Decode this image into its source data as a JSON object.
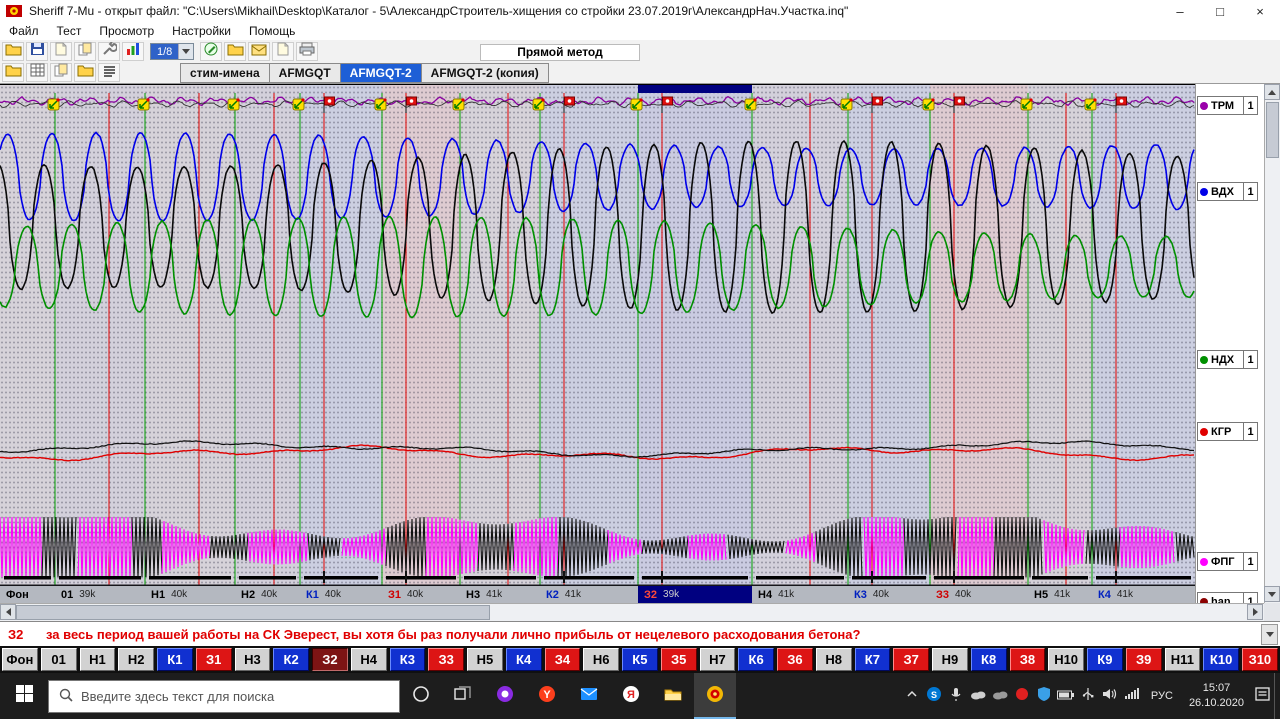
{
  "window": {
    "title": "Sheriff 7-Mu - открыт файл: \"C:\\Users\\Mikhail\\Desktop\\Каталог - 5\\АлександрСтроитель-хищения со стройки 23.07.2019г\\АлександрНач.Участка.inq\"",
    "menu": [
      "Файл",
      "Тест",
      "Просмотр",
      "Настройки",
      "Помощь"
    ],
    "controls": [
      {
        "name": "minimize-button",
        "glyph": "–"
      },
      {
        "name": "maximize-button",
        "glyph": "□"
      },
      {
        "name": "close-button",
        "glyph": "×"
      }
    ]
  },
  "toolbar": {
    "scale_value": "1/8",
    "method_label": "Прямой метод",
    "row1a_icons": [
      "open-file",
      "save",
      "page",
      "copy",
      "wrench",
      "chart"
    ],
    "row1b_icons": [
      "pencil",
      "open-file",
      "mail-tb",
      "page",
      "print"
    ],
    "row2_icons": [
      "open-file",
      "grid",
      "copy",
      "open-file",
      "list"
    ]
  },
  "tabs": [
    {
      "label": "стим-имена",
      "active": false
    },
    {
      "label": "AFMGQT",
      "active": false
    },
    {
      "label": "AFMGQT-2",
      "active": true
    },
    {
      "label": "AFMGQT-2 (копия)",
      "active": false
    }
  ],
  "channels": [
    {
      "label": "ТРМ",
      "index": "1",
      "color": "#9900aa"
    },
    {
      "label": "ВДХ",
      "index": "1",
      "color": "#0000e8"
    },
    {
      "label": "НДХ",
      "index": "1",
      "color": "#009000"
    },
    {
      "label": "КГР",
      "index": "1",
      "color": "#e00000"
    },
    {
      "label": "ФПГ",
      "index": "1",
      "color": "#ff00ff"
    },
    {
      "label": "han",
      "index": "1",
      "color": "#8b0000"
    }
  ],
  "chart": {
    "segments": [
      {
        "label": "Фон",
        "sub": "",
        "type": "fon",
        "start": 0,
        "end": 55
      },
      {
        "label": "01",
        "sub": "39k",
        "type": "n",
        "start": 55,
        "end": 145
      },
      {
        "label": "Н1",
        "sub": "40k",
        "type": "n",
        "start": 145,
        "end": 235
      },
      {
        "label": "Н2",
        "sub": "40k",
        "type": "n",
        "start": 235,
        "end": 300
      },
      {
        "label": "К1",
        "sub": "40k",
        "type": "k",
        "start": 300,
        "end": 382
      },
      {
        "label": "З1",
        "sub": "40k",
        "type": "z",
        "start": 382,
        "end": 460
      },
      {
        "label": "Н3",
        "sub": "41k",
        "type": "n",
        "start": 460,
        "end": 540
      },
      {
        "label": "К2",
        "sub": "41k",
        "type": "k",
        "start": 540,
        "end": 638
      },
      {
        "label": "З2",
        "sub": "39k",
        "type": "z",
        "start": 638,
        "end": 752,
        "selected": true
      },
      {
        "label": "Н4",
        "sub": "41k",
        "type": "n",
        "start": 752,
        "end": 848
      },
      {
        "label": "К3",
        "sub": "40k",
        "type": "k",
        "start": 848,
        "end": 930
      },
      {
        "label": "З3",
        "sub": "40k",
        "type": "z",
        "start": 930,
        "end": 1028
      },
      {
        "label": "Н5",
        "sub": "41k",
        "type": "n",
        "start": 1028,
        "end": 1092
      },
      {
        "label": "К4",
        "sub": "41k",
        "type": "k",
        "start": 1092,
        "end": 1195
      }
    ]
  },
  "question": {
    "id": "З2",
    "text": "за весь период вашей работы на СК Эверест, вы хотя бы раз получали лично прибыль от нецелевого расходования бетона?"
  },
  "question_buttons": [
    {
      "label": "Фон",
      "type": "n"
    },
    {
      "label": "01",
      "type": "n"
    },
    {
      "label": "Н1",
      "type": "n"
    },
    {
      "label": "Н2",
      "type": "n"
    },
    {
      "label": "К1",
      "type": "k"
    },
    {
      "label": "З1",
      "type": "z"
    },
    {
      "label": "Н3",
      "type": "n"
    },
    {
      "label": "К2",
      "type": "k"
    },
    {
      "label": "З2",
      "type": "z",
      "selected": true
    },
    {
      "label": "Н4",
      "type": "n"
    },
    {
      "label": "К3",
      "type": "k"
    },
    {
      "label": "З3",
      "type": "z"
    },
    {
      "label": "Н5",
      "type": "n"
    },
    {
      "label": "К4",
      "type": "k"
    },
    {
      "label": "З4",
      "type": "z"
    },
    {
      "label": "Н6",
      "type": "n"
    },
    {
      "label": "К5",
      "type": "k"
    },
    {
      "label": "З5",
      "type": "z"
    },
    {
      "label": "Н7",
      "type": "n"
    },
    {
      "label": "К6",
      "type": "k"
    },
    {
      "label": "З6",
      "type": "z"
    },
    {
      "label": "Н8",
      "type": "n"
    },
    {
      "label": "К7",
      "type": "k"
    },
    {
      "label": "З7",
      "type": "z"
    },
    {
      "label": "Н9",
      "type": "n"
    },
    {
      "label": "К8",
      "type": "k"
    },
    {
      "label": "З8",
      "type": "z"
    },
    {
      "label": "Н10",
      "type": "n"
    },
    {
      "label": "К9",
      "type": "k"
    },
    {
      "label": "З9",
      "type": "z"
    },
    {
      "label": "Н11",
      "type": "n"
    },
    {
      "label": "К10",
      "type": "k"
    },
    {
      "label": "З10",
      "type": "z"
    }
  ],
  "taskbar": {
    "search_placeholder": "Введите здесь текст для поиска",
    "apps": [
      "cortana",
      "task-view",
      "app-purple",
      "yandex",
      "mail",
      "yandex-browser",
      "explorer",
      "sheriff"
    ],
    "active_app": "sheriff",
    "tray": [
      "tray-expand",
      "skype",
      "microphone",
      "onedrive",
      "cloud",
      "alert",
      "shield",
      "battery",
      "usb",
      "volume",
      "network"
    ],
    "lang": "РУС",
    "time": "15:07",
    "date": "26.10.2020"
  }
}
